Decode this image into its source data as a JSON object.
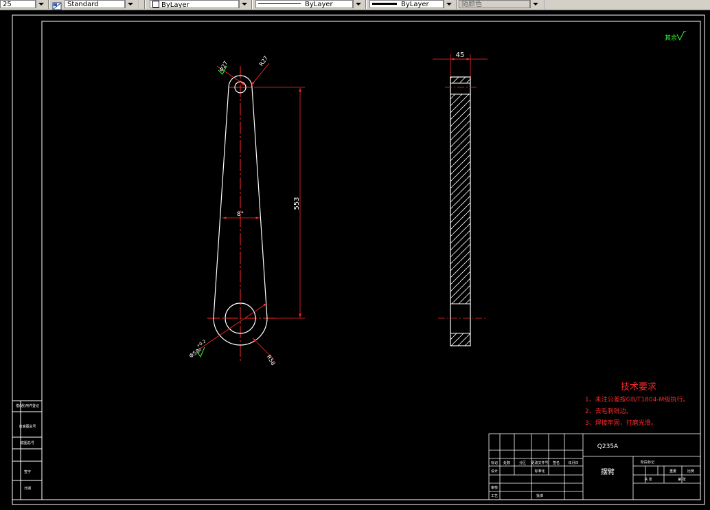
{
  "toolbar": {
    "textstyle_prefix": "25",
    "dimstyle_value": "Standard",
    "layer_value": "ByLayer",
    "linetype_value": "ByLayer",
    "lineweight_value": "ByLayer",
    "plotstyle_value": "随颜色"
  },
  "drawing": {
    "roughness_note": "其余",
    "front_view": {
      "dim_small_hole": "Φ27",
      "dim_small_radius": "R27",
      "dim_taper_angle": "8°",
      "dim_center_distance": "553",
      "dim_big_hole": "Φ58",
      "dim_big_hole_tol_upper": "+0.2",
      "dim_big_hole_tol_lower": "0",
      "dim_big_radius": "R58"
    },
    "side_view": {
      "dim_thickness": "45"
    },
    "tech_requirements": {
      "title": "技术要求",
      "items": [
        "1、未注公差按GB/T1804-M级执行。",
        "2、去毛刺锐边。",
        "3、焊接牢固，打磨光滑。"
      ]
    },
    "title_block": {
      "material": "Q235A",
      "part_name": "摆臂",
      "header_cells": [
        "标记",
        "处数",
        "分区",
        "更改文件号",
        "签名",
        "年月日"
      ],
      "design_label": "设计",
      "standard_label": "标准化",
      "check_label": "审核",
      "process_label": "工艺",
      "approve_label": "批准",
      "stage_label": "阶段标记",
      "weight_label": "重量",
      "scale_label": "比例",
      "sheet_total_label": "共  张",
      "sheet_label": "第  张"
    },
    "side_strip": {
      "cells": [
        "借(通)用件登记",
        "旧底图总号",
        "底图总号",
        "签字",
        "日期"
      ]
    }
  },
  "colors": {
    "background": "#000000",
    "drawing_lines": "#ffffff",
    "dimension": "#ff2a2a",
    "roughness": "#33ff33",
    "toolbar_face": "#d4d0c8"
  }
}
